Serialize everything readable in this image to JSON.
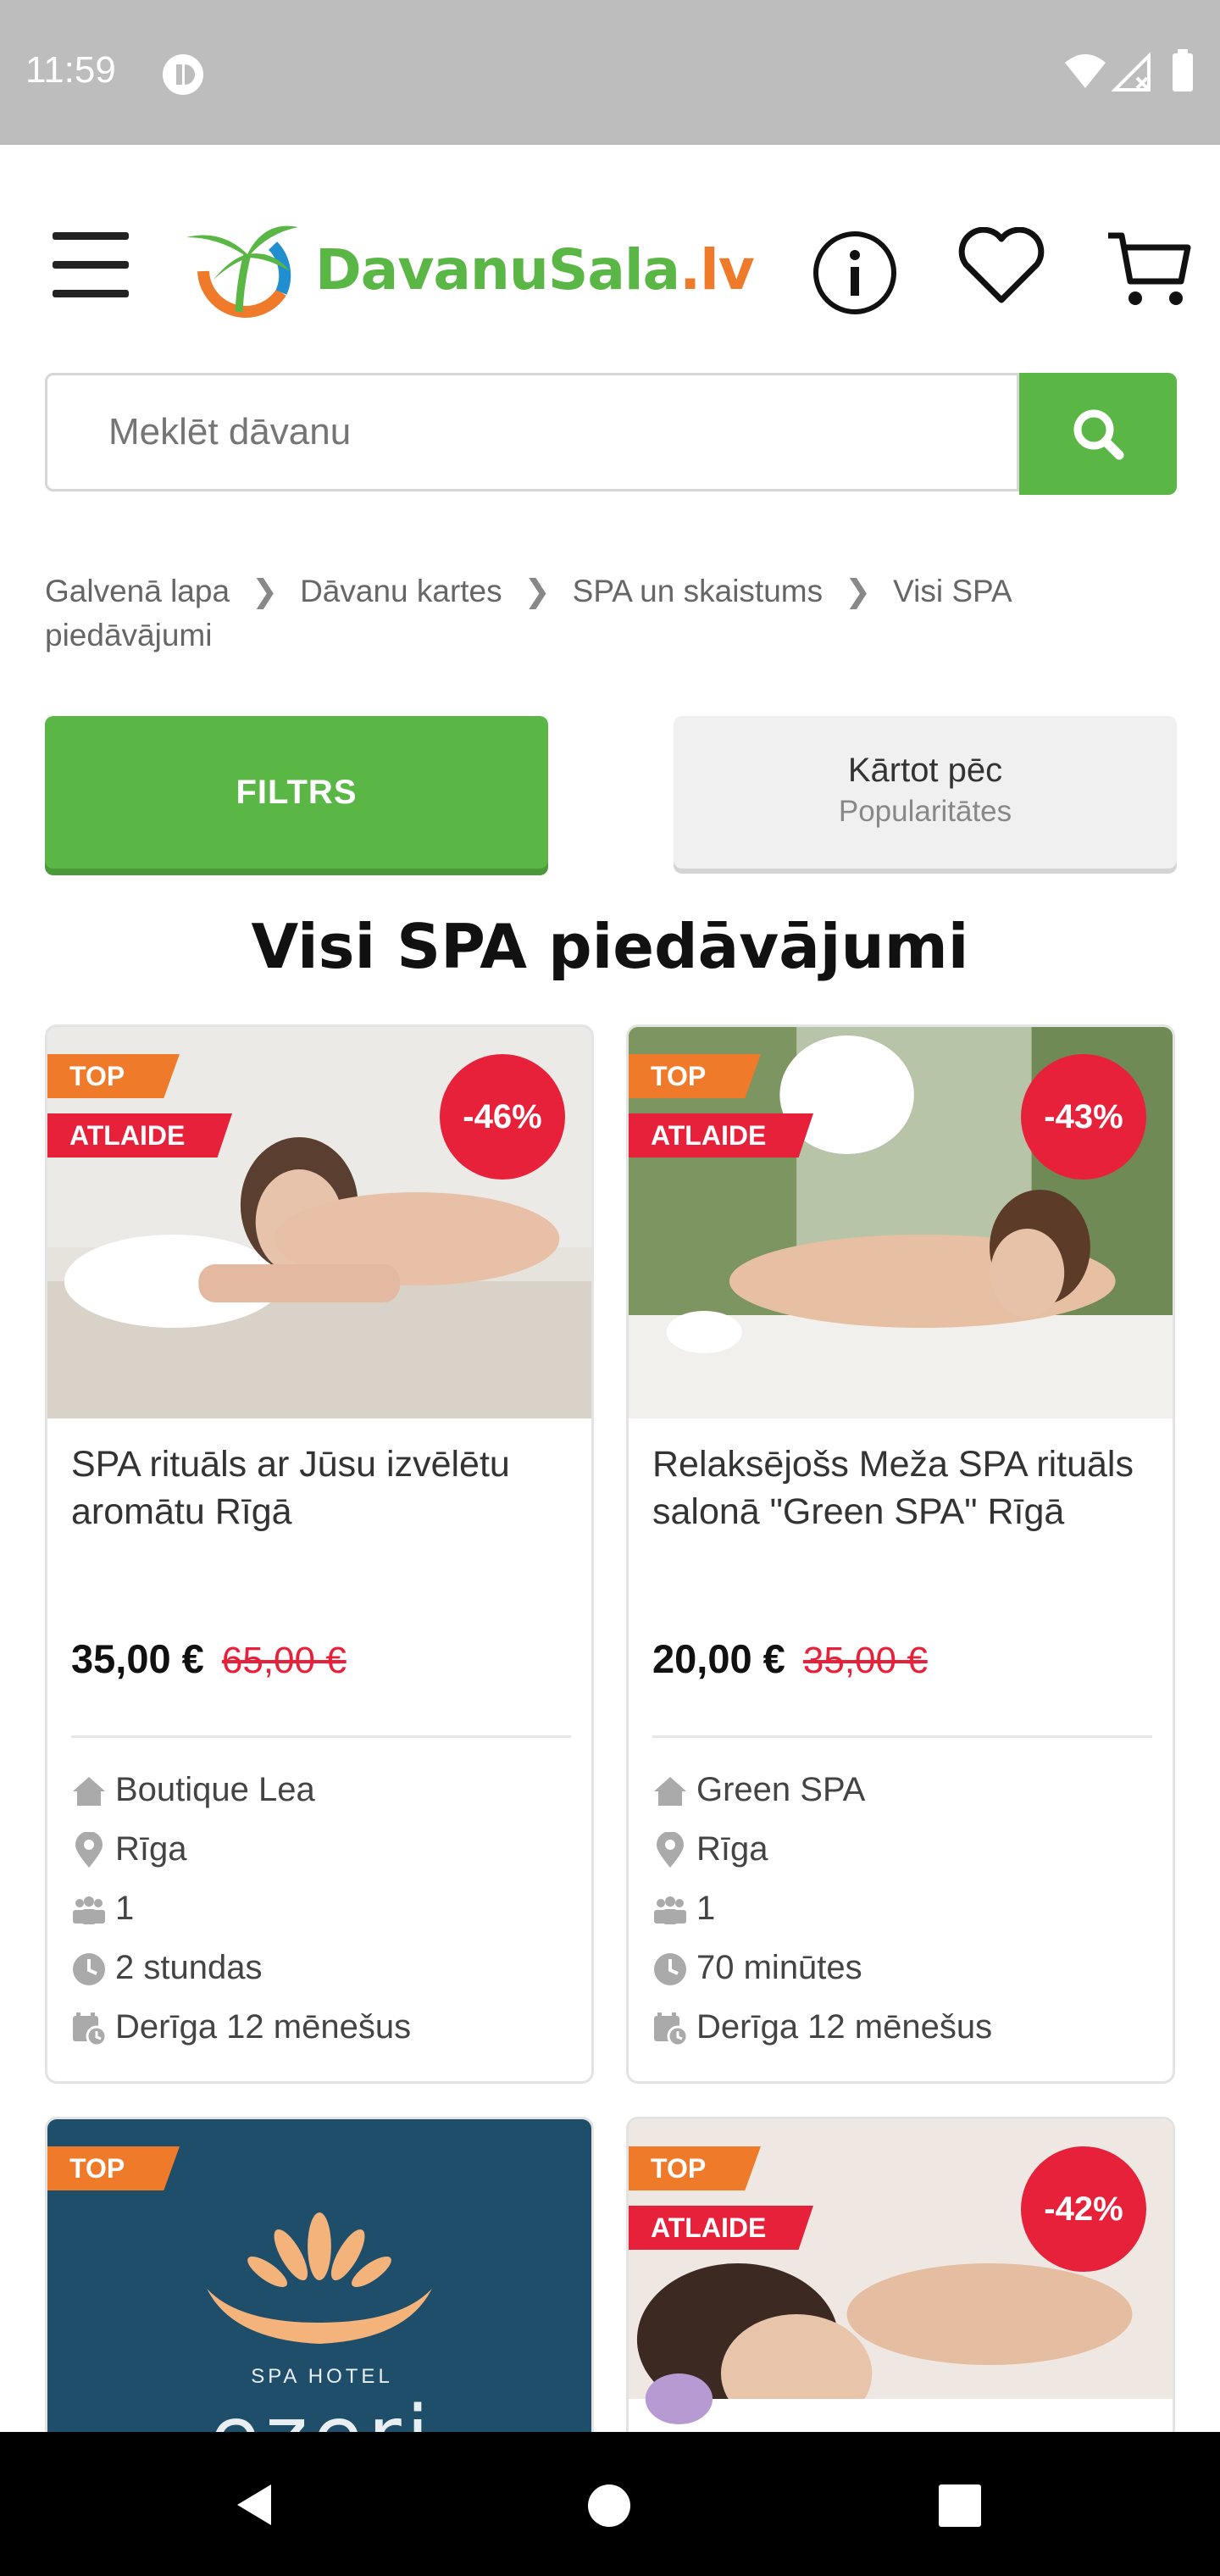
{
  "status_bar": {
    "time": "11:59"
  },
  "header": {
    "logo_text": "DavanuSala",
    "logo_suffix": ".lv"
  },
  "search": {
    "placeholder": "Meklēt dāvanu"
  },
  "breadcrumb": [
    "Galvenā lapa",
    "Dāvanu kartes",
    "SPA un skaistums",
    "Visi SPA piedāvājumi"
  ],
  "filter_button": "FILTRS",
  "sort": {
    "label": "Kārtot pēc",
    "value": "Popularitātes"
  },
  "page_title": "Visi SPA piedāvājumi",
  "colors": {
    "brand_green": "#5ab746",
    "accent_orange": "#ef7b2a",
    "discount_red": "#e8213b"
  },
  "products": [
    {
      "badges": [
        "TOP",
        "ATLAIDE"
      ],
      "discount": "-46%",
      "title": "SPA rituāls ar Jūsu izvēlētu aromātu Rīgā",
      "price": "35,00 €",
      "old_price": "65,00 €",
      "vendor": "Boutique Lea",
      "city": "Rīga",
      "persons": "1",
      "duration": "2 stundas",
      "validity": "Derīga 12 mēnešus"
    },
    {
      "badges": [
        "TOP",
        "ATLAIDE"
      ],
      "discount": "-43%",
      "title": "Relaksējošs Meža SPA rituāls salonā \"Green SPA\" Rīgā",
      "price": "20,00 €",
      "old_price": "35,00 €",
      "vendor": "Green SPA",
      "city": "Rīga",
      "persons": "1",
      "duration": "70 minūtes",
      "validity": "Derīga 12 mēnešus"
    },
    {
      "badges": [
        "TOP"
      ],
      "logo_small": "SPA HOTEL",
      "logo_big": "ezeri"
    },
    {
      "badges": [
        "TOP",
        "ATLAIDE"
      ],
      "discount": "-42%"
    }
  ]
}
